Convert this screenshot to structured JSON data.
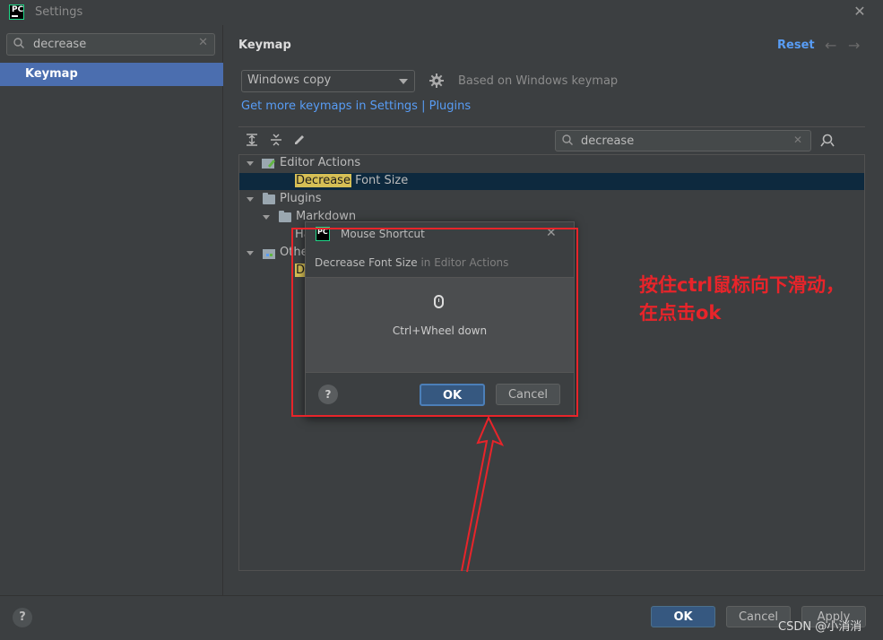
{
  "window": {
    "title": "Settings",
    "close_glyph": "✕"
  },
  "left": {
    "search_value": "decrease",
    "clear_glyph": "✕",
    "selected_item": "Keymap"
  },
  "right": {
    "section_title": "Keymap",
    "reset_label": "Reset",
    "back_glyph": "←",
    "forward_glyph": "→",
    "keymap_value": "Windows copy",
    "based_on": "Based on Windows keymap",
    "get_more": "Get more keymaps in Settings | Plugins",
    "search_value": "decrease",
    "clear_glyph": "✕"
  },
  "tree": {
    "editor_actions": "Editor Actions",
    "decrease_hl": "Decrease",
    "font_size_rest": " Font Size",
    "plugins": "Plugins",
    "markdown": "Markdown",
    "ha_partial": "Ha",
    "other_partial": "Othe",
    "d_partial": "D"
  },
  "popup": {
    "title": "Mouse Shortcut",
    "close_glyph": "✕",
    "action": "Decrease Font Size",
    "context": " in Editor Actions",
    "shortcut": "Ctrl+Wheel down",
    "help_glyph": "?",
    "ok_label": "OK",
    "cancel_label": "Cancel"
  },
  "footer": {
    "help_glyph": "?",
    "ok_label": "OK",
    "cancel_label": "Cancel",
    "apply_label": "Apply"
  },
  "annotation": {
    "line1": "按住ctrl鼠标向下滑动，",
    "line2": "在点击ok",
    "color": "#e8242a"
  },
  "watermark": "CSDN @小消消",
  "colors": {
    "accent": "#589df6",
    "selection": "#4b6eaf",
    "highlight": "#d6bf55",
    "primary_button": "#365880"
  }
}
